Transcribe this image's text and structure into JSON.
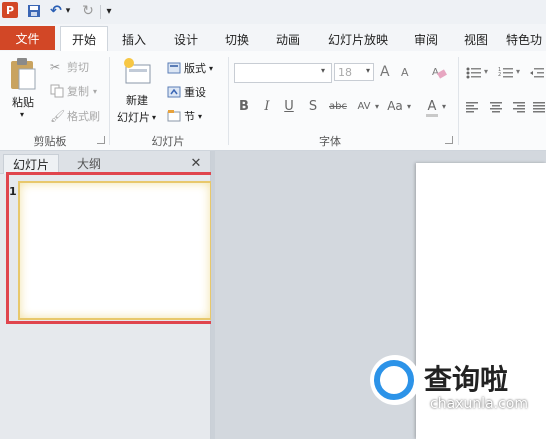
{
  "app": {
    "icon_letter": "P",
    "icon": "powerpoint-app-icon"
  },
  "quick_access": {
    "items": [
      {
        "name": "save-icon",
        "glyph": "💾"
      },
      {
        "name": "undo-icon",
        "glyph": "↶"
      },
      {
        "name": "undo-dropdown-icon",
        "glyph": "▾"
      },
      {
        "name": "redo-icon",
        "glyph": "↻"
      },
      {
        "name": "customize-qat-icon",
        "glyph": "⩡"
      }
    ]
  },
  "tabs": [
    "文件",
    "开始",
    "插入",
    "设计",
    "切换",
    "动画",
    "幻灯片放映",
    "审阅",
    "视图",
    "特色功"
  ],
  "active_tab": "开始",
  "colors": {
    "file_tab": "#d24726",
    "highlight_frame": "#e0454d",
    "thumb_border": "#e8c86c",
    "watermark_blue": "#2c93e8"
  },
  "clipboard": {
    "paste_label": "粘贴",
    "cut_label": "剪切",
    "copy_label": "复制",
    "format_painter_label": "格式刷",
    "group_label": "剪贴板"
  },
  "slides_group": {
    "new_slide_line1": "新建",
    "new_slide_line2": "幻灯片",
    "layout_label": "版式",
    "reset_label": "重设",
    "section_label": "节",
    "group_label": "幻灯片"
  },
  "font_group": {
    "font_size": "18",
    "grow_glyph": "A",
    "shrink_glyph": "A",
    "bold": "B",
    "italic": "I",
    "underline": "U",
    "shadow": "S",
    "strike": "abc",
    "spacing": "AV",
    "case": "Aa",
    "color": "A",
    "group_label": "字体"
  },
  "panes": {
    "slides_tab": "幻灯片",
    "outline_tab": "大纲",
    "close_glyph": "✕",
    "slide_number": "1"
  },
  "watermark": {
    "title": "查询啦",
    "url": "chaxunla.com"
  }
}
